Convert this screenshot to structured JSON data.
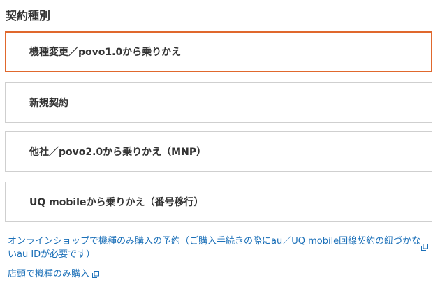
{
  "section": {
    "title": "契約種別"
  },
  "options": [
    {
      "label": "機種変更／povo1.0から乗りかえ",
      "selected": true
    },
    {
      "label": "新規契約",
      "selected": false
    },
    {
      "label": "他社／povo2.0から乗りかえ（MNP）",
      "selected": false
    },
    {
      "label": "UQ mobileから乗りかえ（番号移行）",
      "selected": false
    }
  ],
  "links": [
    {
      "text": "オンラインショップで機種のみ購入の予約（ご購入手続きの際にau／UQ mobile回線契約の紐づかないau IDが必要です）",
      "icon": "external-link-icon"
    },
    {
      "text": "店頭で機種のみ購入",
      "icon": "external-link-icon"
    }
  ],
  "colors": {
    "selected_border": "#e0682d",
    "default_border": "#cfcfcf",
    "link": "#1a6fb8",
    "text": "#333333"
  }
}
